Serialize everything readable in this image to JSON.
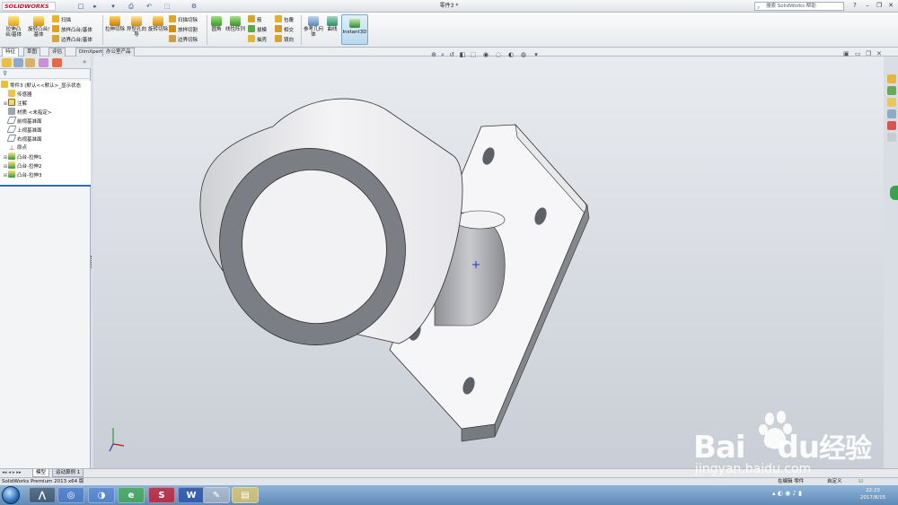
{
  "app": {
    "logo_text": "SOLIDWORKS",
    "document_title": "零件3 *",
    "search_placeholder": "搜索 SolidWorks 帮助"
  },
  "window_controls": {
    "minimize": "–",
    "restore": "❐",
    "close": "✕",
    "help": "?"
  },
  "quick_access": [
    "□",
    "▸",
    "▾",
    "⎙",
    "↶",
    "⬚",
    "⚙"
  ],
  "command_manager": {
    "extruded_boss": "拉伸凸台/基体",
    "revolved_boss": "旋转凸台/基体",
    "swept_boss": "扫描",
    "lofted_boss": "放样凸台/基体",
    "boundary_boss": "边界凸台/基体",
    "extruded_cut": "拉伸切除",
    "hole_wizard": "异型孔向导",
    "revolved_cut": "旋转切除",
    "swept_cut": "扫描切除",
    "lofted_cut": "放样切割",
    "boundary_cut": "边界切除",
    "fillet": "圆角",
    "linear_pattern": "线性阵列",
    "rib": "筋",
    "draft": "拔模",
    "shell": "抽壳",
    "wrap": "包覆",
    "intersect": "相交",
    "mirror": "镜向",
    "reference_geometry": "参考几何体",
    "curves": "曲线",
    "instant3d": "Instant3D"
  },
  "tabs": [
    "特征",
    "草图",
    "评估",
    "DimXpert",
    "办公室产品"
  ],
  "feature_tree": {
    "root": "零件3  (默认<<默认>_显示状态",
    "items": [
      "传感器",
      "注解",
      "材质 <未指定>",
      "前视基准面",
      "上视基准面",
      "右视基准面",
      "原点",
      "凸台-拉伸1",
      "凸台-拉伸2",
      "凸台-拉伸3"
    ]
  },
  "bottom_tabs": [
    "模型",
    "运动算例 1"
  ],
  "status": {
    "left": "SolidWorks Premium 2013 x64 版",
    "editing": "在编辑 零件",
    "custom": "自定义"
  },
  "taskbar": {
    "time": "22:23",
    "date": "2017/8/15"
  },
  "watermark": {
    "brand": "Bai",
    "brand2": "du",
    "cn": "经验",
    "url": "jingyan.baidu.com"
  },
  "colors": {
    "accent": "#2d6fb3",
    "brand_red": "#c8102e",
    "part_face": "#f2f2f4",
    "part_shade": "#7a7d82"
  }
}
